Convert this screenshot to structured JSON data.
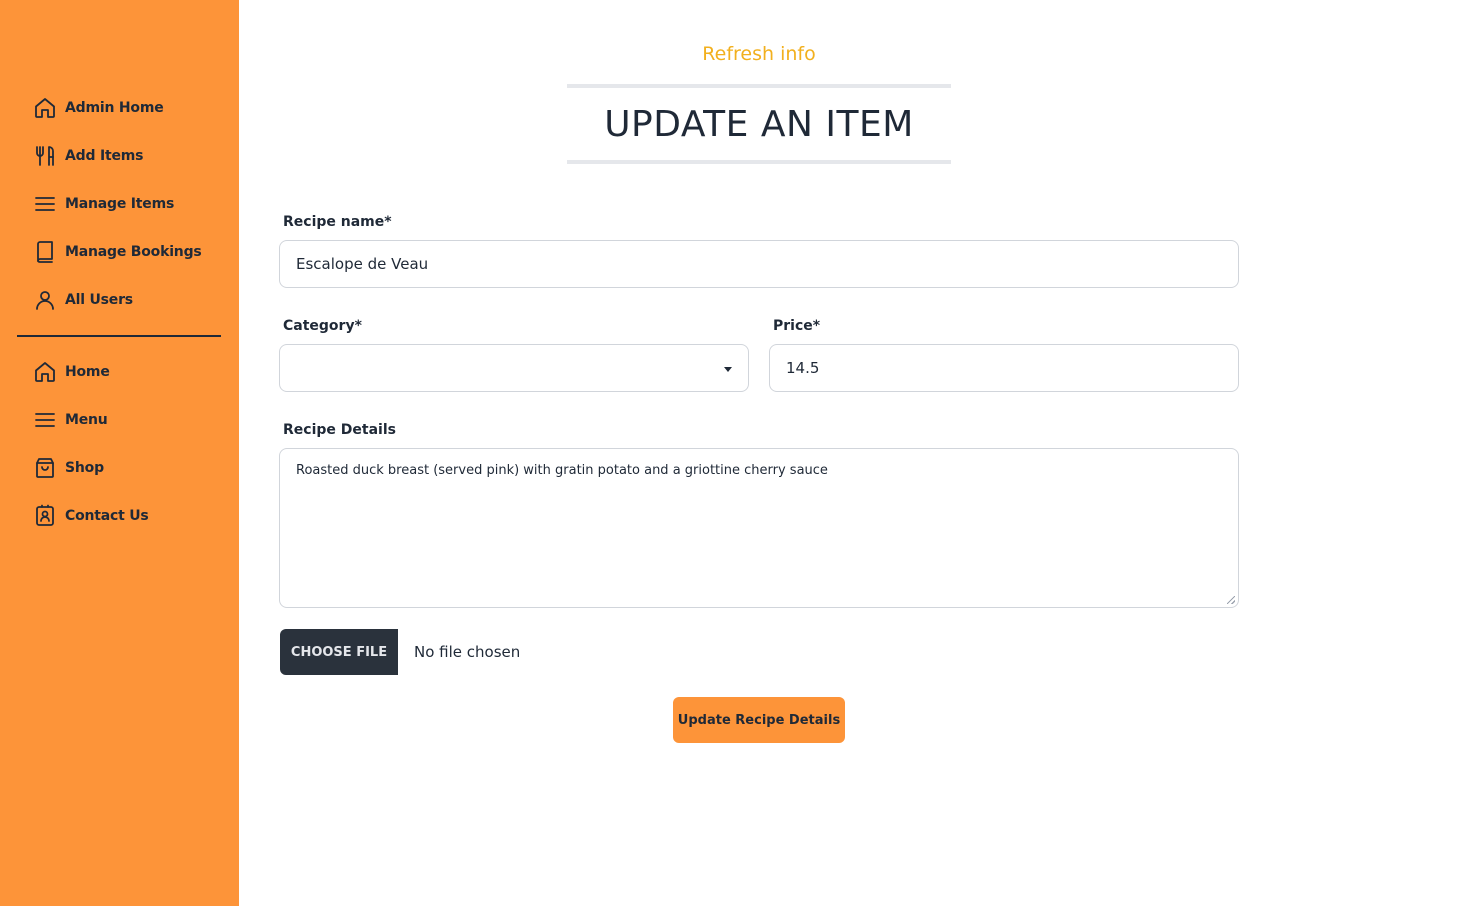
{
  "sidebar": {
    "admin_items": [
      {
        "label": "Admin Home",
        "icon": "home-icon"
      },
      {
        "label": "Add Items",
        "icon": "utensils-icon"
      },
      {
        "label": "Manage Items",
        "icon": "menu-lines-icon"
      },
      {
        "label": "Manage Bookings",
        "icon": "book-icon"
      },
      {
        "label": "All Users",
        "icon": "user-icon"
      }
    ],
    "site_items": [
      {
        "label": "Home",
        "icon": "home-icon"
      },
      {
        "label": "Menu",
        "icon": "menu-lines-icon"
      },
      {
        "label": "Shop",
        "icon": "shopping-bag-icon"
      },
      {
        "label": "Contact Us",
        "icon": "contact-card-icon"
      }
    ]
  },
  "header": {
    "subtitle": "Refresh info",
    "title": "UPDATE AN ITEM"
  },
  "form": {
    "recipe_name": {
      "label": "Recipe name*",
      "value": "Escalope de Veau"
    },
    "category": {
      "label": "Category*",
      "value": ""
    },
    "price": {
      "label": "Price*",
      "value": "14.5"
    },
    "details": {
      "label": "Recipe Details",
      "value": "Roasted duck breast (served pink) with gratin potato and a griottine cherry sauce"
    },
    "file": {
      "button_label": "CHOOSE FILE",
      "status": "No file chosen"
    },
    "submit_label": "Update Recipe Details"
  },
  "colors": {
    "sidebar_bg": "#fd9439",
    "accent_text": "#f2b01e",
    "dark": "#1f2937",
    "file_button_bg": "#2a323c"
  }
}
